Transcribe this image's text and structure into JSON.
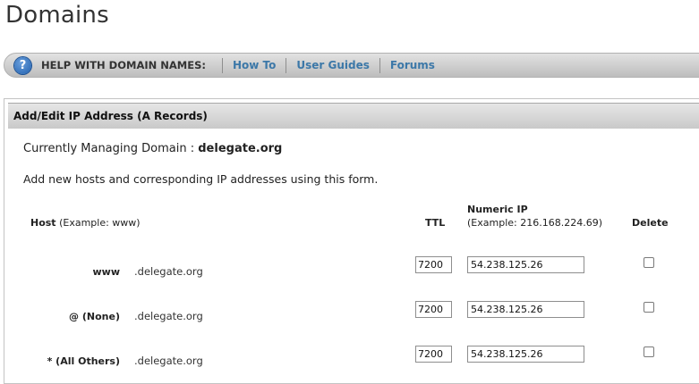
{
  "page": {
    "title": "Domains"
  },
  "help_bar": {
    "icon": "help-question-icon",
    "label": "HELP WITH DOMAIN NAMES:",
    "links": [
      "How To",
      "User Guides",
      "Forums"
    ],
    "link_color": "#3c78a8"
  },
  "panel": {
    "title": "Add/Edit IP Address (A Records)",
    "managing_prefix": "Currently Managing Domain :",
    "managing_domain": "delegate.org",
    "intro": "Add new hosts and corresponding IP addresses using this form.",
    "columns": {
      "host": "Host",
      "host_example": "(Example: www)",
      "ttl": "TTL",
      "ip": "Numeric IP",
      "ip_example": "(Example: 216.168.224.69)",
      "delete": "Delete"
    },
    "records": [
      {
        "host": "www",
        "suffix": ".delegate.org",
        "ttl": "7200",
        "ip": "54.238.125.26",
        "delete": false
      },
      {
        "host": "@ (None)",
        "suffix": ".delegate.org",
        "ttl": "7200",
        "ip": "54.238.125.26",
        "delete": false
      },
      {
        "host": "* (All Others)",
        "suffix": ".delegate.org",
        "ttl": "7200",
        "ip": "54.238.125.26",
        "delete": false
      }
    ]
  }
}
